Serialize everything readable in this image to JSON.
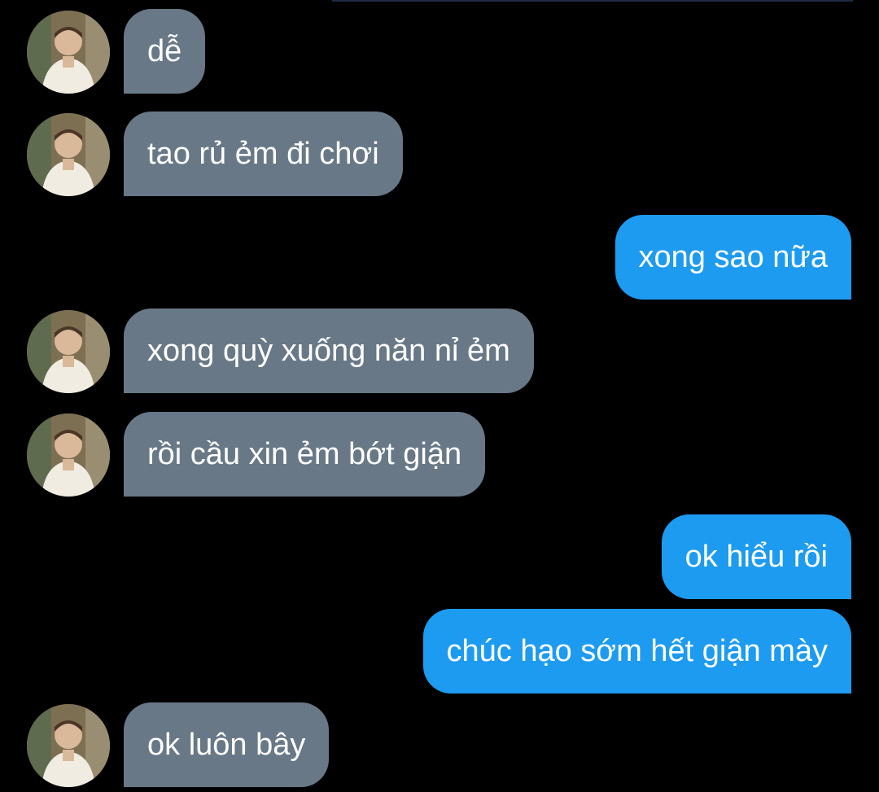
{
  "conversation": {
    "messages": [
      {
        "sender": "them",
        "text": "dễ"
      },
      {
        "sender": "them",
        "text": "tao rủ ẻm đi chơi"
      },
      {
        "sender": "me",
        "text": "xong sao nữa"
      },
      {
        "sender": "them",
        "text": "xong quỳ xuống năn nỉ ẻm"
      },
      {
        "sender": "them",
        "text": "rồi cầu xin ẻm bớt giận"
      },
      {
        "sender": "me",
        "text": "ok hiểu rồi"
      },
      {
        "sender": "me",
        "text": "chúc hạo sớm hết giận mày"
      },
      {
        "sender": "them",
        "text": "ok luôn bây"
      }
    ]
  },
  "colors": {
    "background": "#000000",
    "incoming_bubble": "#687887",
    "outgoing_bubble": "#1d9bf0",
    "text": "#ffffff"
  }
}
